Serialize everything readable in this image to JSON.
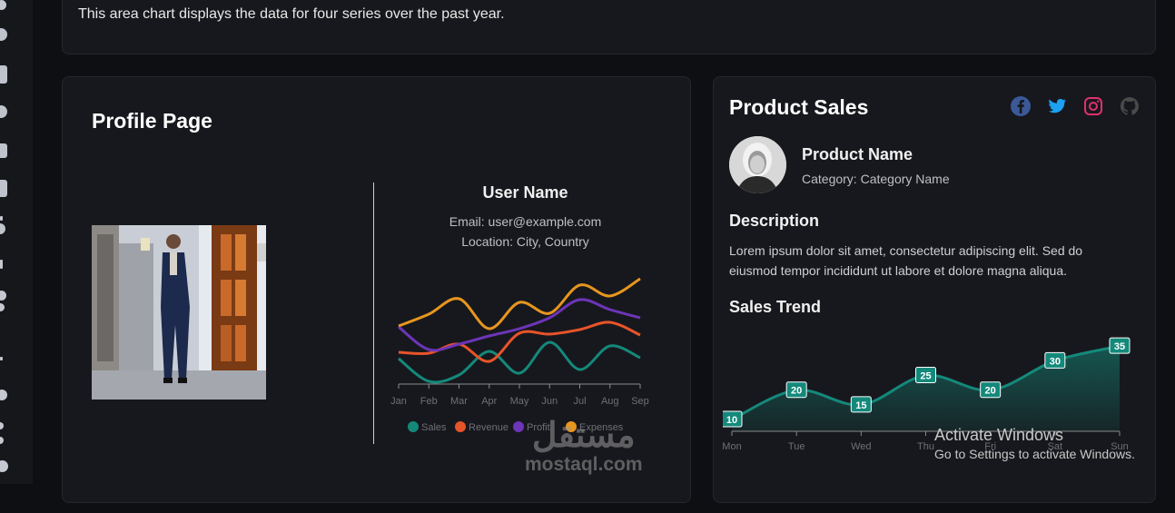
{
  "top_card": {
    "text": "This area chart displays the data for four series over the past year."
  },
  "profile": {
    "title": "Profile Page",
    "user_name": "User Name",
    "email": "Email: user@example.com",
    "location": "Location: City, Country"
  },
  "product": {
    "title": "Product Sales",
    "name": "Product Name",
    "category": "Category: Category Name",
    "description_title": "Description",
    "description": "Lorem ipsum dolor sit amet, consectetur adipiscing elit. Sed do eiusmod tempor incididunt ut labore et dolore magna aliqua.",
    "trend_title": "Sales Trend",
    "social": [
      {
        "icon": "facebook-icon",
        "color": "#3b5998"
      },
      {
        "icon": "twitter-icon",
        "color": "#1da1f2"
      },
      {
        "icon": "instagram-icon",
        "color": "#e1306c"
      },
      {
        "icon": "github-icon",
        "color": "#4a4a4a"
      }
    ]
  },
  "chart_data": [
    {
      "type": "line",
      "categories": [
        "Jan",
        "Feb",
        "Mar",
        "Apr",
        "May",
        "Jun",
        "Jul",
        "Aug",
        "Sep"
      ],
      "series": [
        {
          "name": "Sales",
          "color": "#14897b",
          "values": [
            30,
            5,
            12,
            38,
            14,
            48,
            18,
            44,
            31
          ]
        },
        {
          "name": "Revenue",
          "color": "#e8542a",
          "values": [
            37,
            36,
            46,
            27,
            58,
            57,
            62,
            70,
            56
          ]
        },
        {
          "name": "Profit",
          "color": "#6d35b8",
          "values": [
            65,
            40,
            46,
            55,
            63,
            75,
            95,
            84,
            75
          ]
        },
        {
          "name": "Expenses",
          "color": "#e7961e",
          "values": [
            66,
            79,
            96,
            63,
            92,
            80,
            111,
            99,
            118
          ]
        }
      ],
      "legend": "bottom",
      "ylim": [
        0,
        130
      ]
    },
    {
      "type": "area",
      "categories": [
        "Mon",
        "Tue",
        "Wed",
        "Thu",
        "Fri",
        "Sat",
        "Sun"
      ],
      "values": [
        10,
        20,
        15,
        25,
        20,
        30,
        35
      ],
      "color": "#14897b",
      "ylim": [
        6,
        40
      ]
    }
  ],
  "watermark": {
    "arabic": "مستقل",
    "latin": "mostaql.com"
  },
  "activation": {
    "title": "Activate Windows",
    "subtitle": "Go to Settings to activate Windows."
  }
}
